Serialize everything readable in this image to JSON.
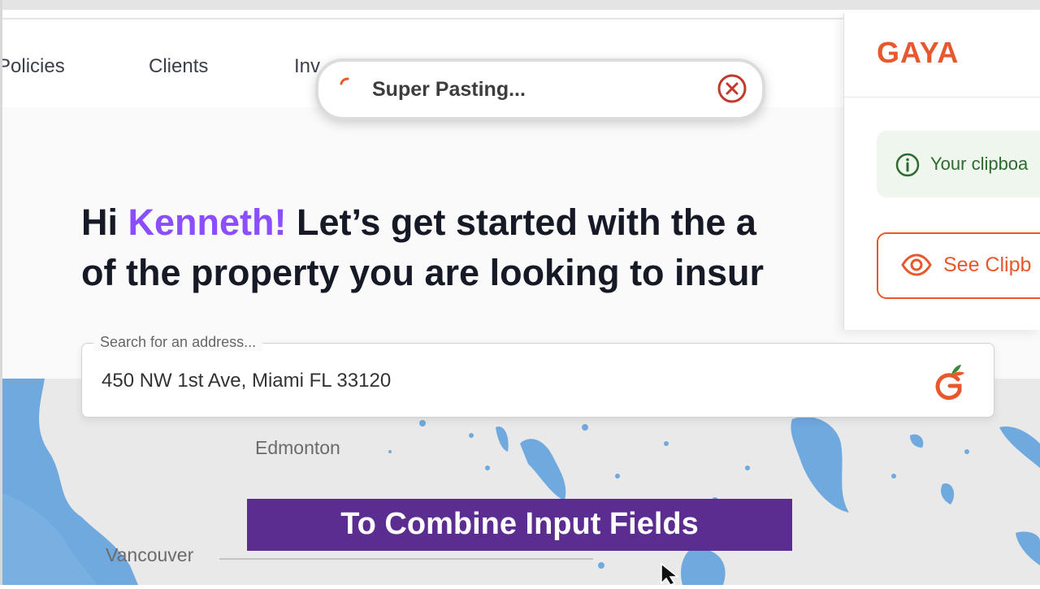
{
  "nav": {
    "items": [
      "Policies",
      "Clients",
      "Inv"
    ]
  },
  "heading": {
    "greeting": "Hi",
    "name": "Kenneth!",
    "line1_rest": "Let’s get started with the a",
    "line2": "of the property you are looking to insur"
  },
  "search": {
    "placeholder": "Search for an address...",
    "value": "450 NW 1st Ave, Miami FL 33120",
    "logo_icon": "gaya-g-icon"
  },
  "toast": {
    "text": "Super Pasting...",
    "close_icon": "close-circle-icon"
  },
  "panel": {
    "brand": "GAYA",
    "info_text": "Your clipboa",
    "button_label": "See Clipb"
  },
  "map": {
    "labels": [
      "Edmonton",
      "Vancouver"
    ]
  },
  "caption": {
    "text": "To Combine Input Fields"
  },
  "colors": {
    "accent_purple": "#8a4dff",
    "brand_orange": "#e8582c",
    "caption_bg": "#5c2d91",
    "info_green": "#2e6b2e",
    "water": "#6fa9de"
  }
}
